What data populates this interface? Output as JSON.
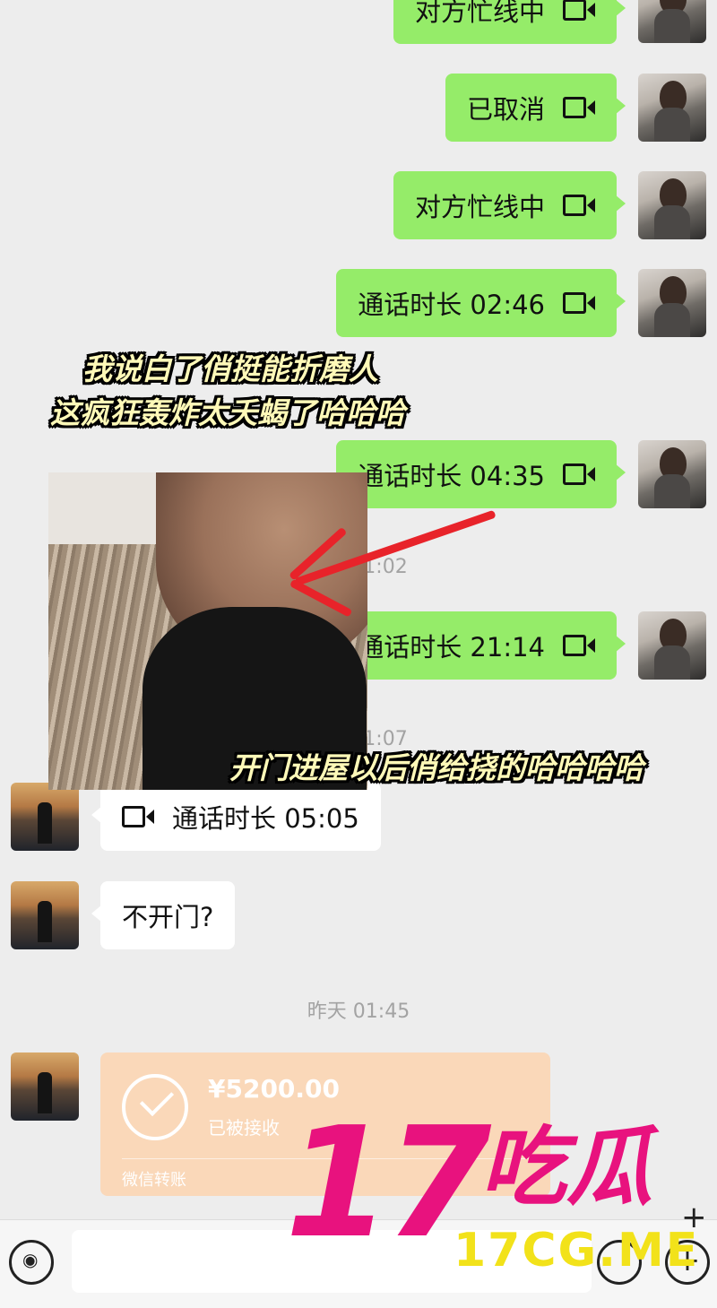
{
  "messages_right": [
    {
      "text": "对方忙线中",
      "icon": "video-call-icon"
    },
    {
      "text": "已取消",
      "icon": "video-call-icon"
    },
    {
      "text": "对方忙线中",
      "icon": "video-call-icon"
    },
    {
      "text": "通话时长 02:46",
      "icon": "video-call-icon"
    },
    {
      "text": "通话时长 04:35",
      "icon": "video-call-icon"
    },
    {
      "text": "通话时长 21:14",
      "icon": "video-call-icon"
    }
  ],
  "timestamps": {
    "t1": "1:02",
    "t2": "1:07",
    "t3": "昨天 01:45"
  },
  "messages_left": [
    {
      "text": "通话时长 05:05",
      "icon": "video-call-icon"
    },
    {
      "text": "不开门?"
    }
  ],
  "overlay": {
    "caption_top_1": "我说白了俏挺能折磨人",
    "caption_top_2": "这疯狂轰炸太夭蝎了哈哈哈",
    "caption_bottom": "开门进屋以后俏给挠的哈哈哈哈"
  },
  "transfer": {
    "amount": "¥5200.00",
    "status": "已被接收",
    "footer": "微信转账"
  },
  "watermark": {
    "number": "17",
    "chinese": "吃瓜",
    "url": "17CG.ME"
  },
  "colors": {
    "green_bubble": "#95ec69",
    "background": "#ededed",
    "transfer_bg": "#fad8b9",
    "watermark_pink": "#e8127e",
    "watermark_yellow": "#f2e21a",
    "arrow_red": "#e8232a"
  }
}
